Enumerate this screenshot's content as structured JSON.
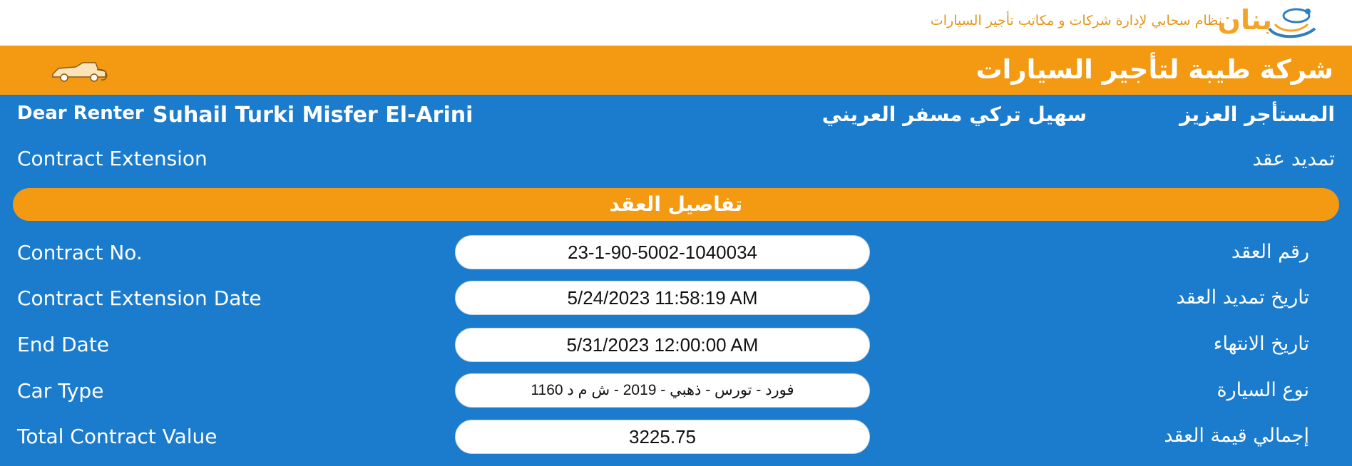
{
  "header": {
    "brand_name": "بنان",
    "brand_tagline": "نظام سحابي لإدارة شركات و مكاتب تأجير السيارات",
    "company_name": "شركة طيبة لتأجير السيارات"
  },
  "greeting": {
    "label_en": "Dear Renter",
    "name_en": "Suhail Turki Misfer El-Arini",
    "label_ar": "المستأجر العزيز",
    "name_ar": "سهيل تركي مسفر العريني"
  },
  "subject": {
    "en": "Contract Extension",
    "ar": "تمديد عقد"
  },
  "section": {
    "title": "تفاصيل العقد"
  },
  "fields": [
    {
      "label_en": "Contract No.",
      "label_ar": "رقم العقد",
      "value": "23-1-90-5002-1040034"
    },
    {
      "label_en": "Contract Extension Date",
      "label_ar": "تاريخ تمديد العقد",
      "value": "5/24/2023 11:58:19 AM"
    },
    {
      "label_en": "End Date",
      "label_ar": "تاريخ الانتهاء",
      "value": "5/31/2023 12:00:00 AM"
    },
    {
      "label_en": "Car Type",
      "label_ar": "نوع السيارة",
      "value": "فورد - تورس - ذهبي - 2019 - ش م د 1160"
    },
    {
      "label_en": "Total Contract Value",
      "label_ar": "إجمالي قيمة العقد",
      "value": "3225.75"
    }
  ],
  "colors": {
    "primary_blue": "#1b7ccd",
    "accent_orange": "#f39a12",
    "brand_orange": "#f4a326"
  },
  "icons": [
    "banan-logo-icon",
    "car-icon"
  ]
}
